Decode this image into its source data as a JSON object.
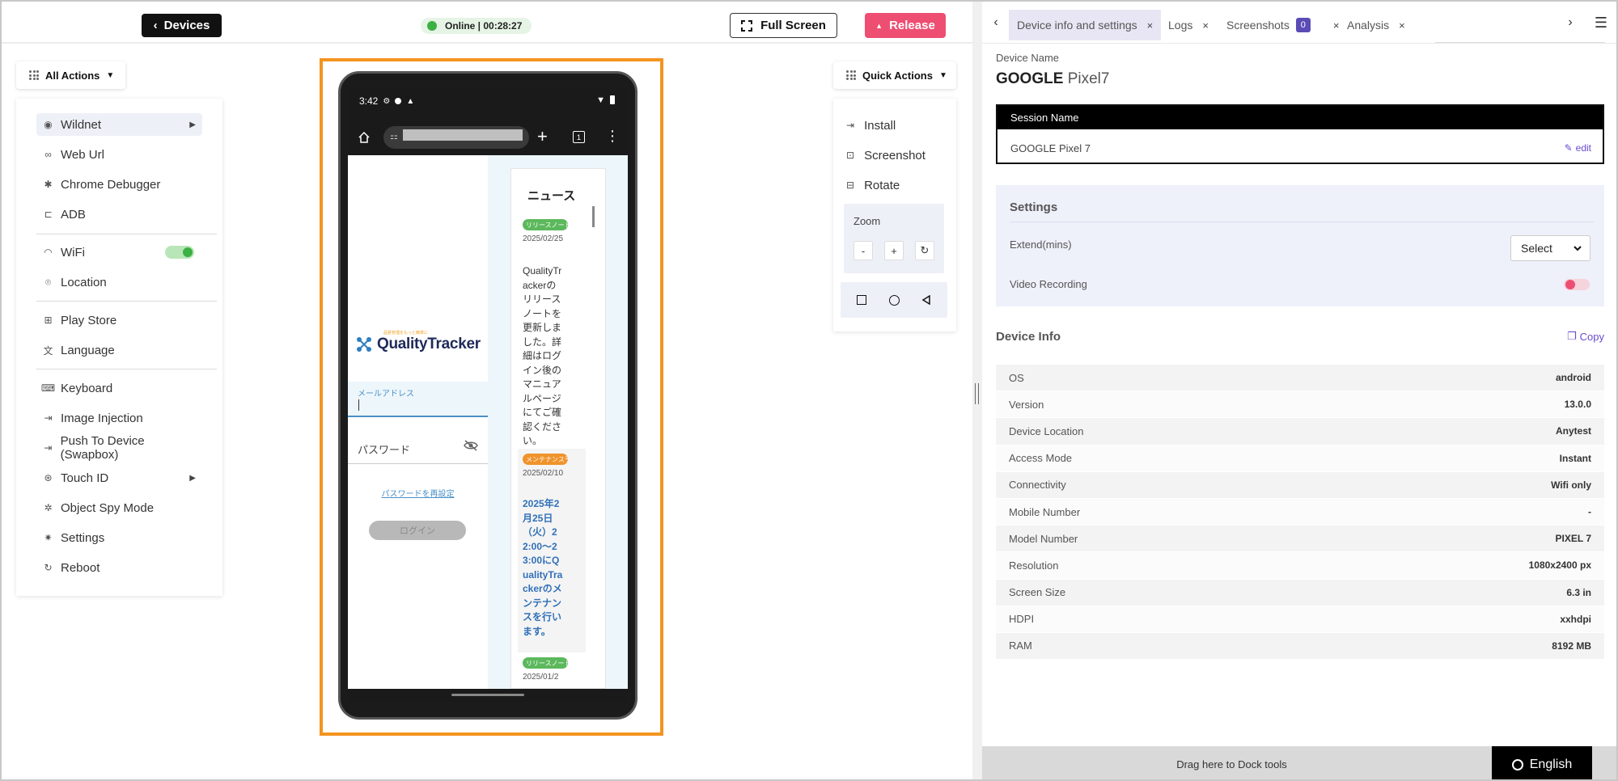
{
  "topbar": {
    "devices_label": "Devices",
    "status_text": "Online | 00:28:27",
    "fullscreen_label": "Full Screen",
    "release_label": "Release"
  },
  "left": {
    "all_actions_label": "All Actions",
    "items": [
      {
        "label": "Wildnet",
        "icon": "wildnet-icon"
      },
      {
        "label": "Web Url",
        "icon": "link-icon"
      },
      {
        "label": "Chrome Debugger",
        "icon": "bug-icon"
      },
      {
        "label": "ADB",
        "icon": "adb-icon"
      },
      {
        "label": "WiFi",
        "icon": "wifi-icon"
      },
      {
        "label": "Location",
        "icon": "location-icon"
      },
      {
        "label": "Play Store",
        "icon": "play-store-icon"
      },
      {
        "label": "Language",
        "icon": "language-icon"
      },
      {
        "label": "Keyboard",
        "icon": "keyboard-icon"
      },
      {
        "label": "Image Injection",
        "icon": "image-injection-icon"
      },
      {
        "label": "Push To Device (Swapbox)",
        "icon": "push-icon"
      },
      {
        "label": "Touch ID",
        "icon": "fingerprint-icon"
      },
      {
        "label": "Object Spy Mode",
        "icon": "spy-icon"
      },
      {
        "label": "Settings",
        "icon": "gear-icon"
      },
      {
        "label": "Reboot",
        "icon": "reboot-icon"
      }
    ]
  },
  "phone": {
    "time": "3:42",
    "logo_text": "QualityTracker",
    "logo_sub": "品質管理をもっと簡単に",
    "email_label": "メールアドレス",
    "password_label": "パスワード",
    "reset_link": "パスワードを再設定",
    "login_label": "ログイン",
    "news_title": "ニュース",
    "news": [
      {
        "badge": "リリースノート",
        "date": "2025/02/25",
        "text": "QualityTrackerのリリースノートを更新しました。詳細はログイン後のマニュアルページにてご確認ください。"
      },
      {
        "badge": "メンテナンス予定",
        "date": "2025/02/10",
        "text": "2025年2月25日（火）22:00〜23:00にQualityTrackerのメンテナンスを行います。"
      },
      {
        "badge": "リリースノート",
        "date": "2025/01/2"
      }
    ]
  },
  "quick": {
    "label": "Quick Actions",
    "install": "Install",
    "screenshot": "Screenshot",
    "rotate": "Rotate",
    "zoom_label": "Zoom",
    "zoom_out": "-",
    "zoom_in": "+"
  },
  "right": {
    "tabs": [
      {
        "label": "Device info and settings"
      },
      {
        "label": "Logs"
      },
      {
        "label": "Screenshots",
        "count": "0"
      },
      {
        "label": "Analysis"
      }
    ],
    "device_name_label": "Device Name",
    "device_brand": "GOOGLE",
    "device_model": "Pixel7",
    "session_header": "Session Name",
    "session_value": "GOOGLE Pixel 7",
    "edit_label": "edit",
    "settings_title": "Settings",
    "extend_label": "Extend(mins)",
    "select_value": "Select",
    "video_label": "Video Recording",
    "video_recording_on": false,
    "device_info_title": "Device Info",
    "copy_label": "Copy",
    "info_rows": [
      {
        "k": "OS",
        "v": "android"
      },
      {
        "k": "Version",
        "v": "13.0.0"
      },
      {
        "k": "Device Location",
        "v": "Anytest"
      },
      {
        "k": "Access Mode",
        "v": "Instant"
      },
      {
        "k": "Connectivity",
        "v": "Wifi only"
      },
      {
        "k": "Mobile Number",
        "v": "-"
      },
      {
        "k": "Model Number",
        "v": "PIXEL 7"
      },
      {
        "k": "Resolution",
        "v": "1080x2400 px"
      },
      {
        "k": "Screen Size",
        "v": "6.3 in"
      },
      {
        "k": "HDPI",
        "v": "xxhdpi"
      },
      {
        "k": "RAM",
        "v": "8192 MB"
      }
    ],
    "dock_text": "Drag here to Dock tools",
    "language_label": "English"
  },
  "colors": {
    "accent_release": "#ee4e72",
    "device_border": "#f3941f",
    "online_green": "#3cb043",
    "purple": "#6b4bd0"
  },
  "wifi_enabled": true
}
